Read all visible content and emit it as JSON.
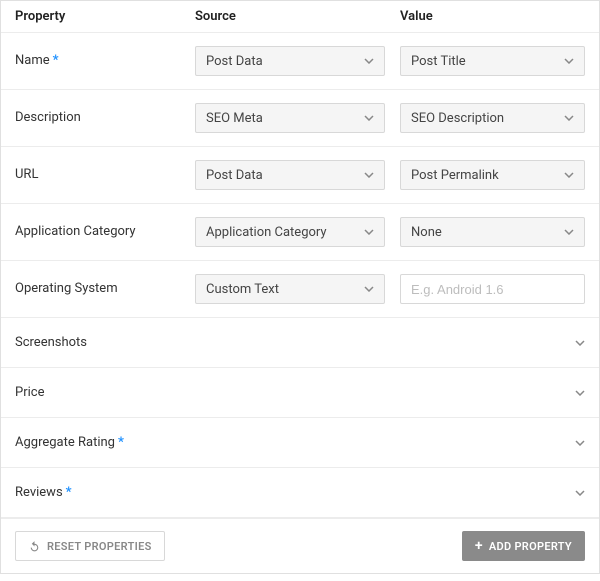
{
  "header": {
    "property": "Property",
    "source": "Source",
    "value": "Value"
  },
  "rows": [
    {
      "label": "Name",
      "required": true,
      "source": "Post Data",
      "value_type": "select",
      "value": "Post Title"
    },
    {
      "label": "Description",
      "required": false,
      "source": "SEO Meta",
      "value_type": "select",
      "value": "SEO Description"
    },
    {
      "label": "URL",
      "required": false,
      "source": "Post Data",
      "value_type": "select",
      "value": "Post Permalink"
    },
    {
      "label": "Application Category",
      "required": false,
      "source": "Application Category",
      "value_type": "select",
      "value": "None"
    },
    {
      "label": "Operating System",
      "required": false,
      "source": "Custom Text",
      "value_type": "text",
      "placeholder": "E.g. Android 1.6",
      "value": ""
    }
  ],
  "sections": [
    {
      "label": "Screenshots",
      "required": false
    },
    {
      "label": "Price",
      "required": false
    },
    {
      "label": "Aggregate Rating",
      "required": true
    },
    {
      "label": "Reviews",
      "required": true
    }
  ],
  "footer": {
    "reset": "RESET PROPERTIES",
    "add": "ADD PROPERTY"
  },
  "symbols": {
    "required": "*",
    "plus": "+"
  }
}
